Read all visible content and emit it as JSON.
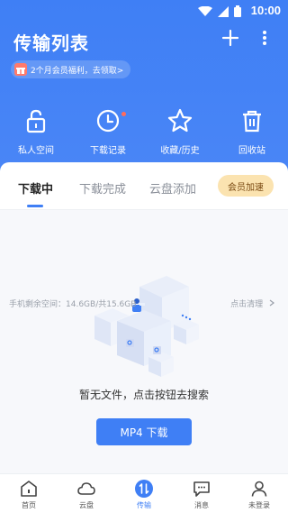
{
  "status_bar": {
    "time": "10:00"
  },
  "header": {
    "title": "传输列表",
    "promo_text": "2个月会员福利，去领取>",
    "plus_icon": "plus-icon",
    "more_icon": "more-vertical-icon"
  },
  "quick_actions": [
    {
      "label": "私人空间",
      "icon": "unlock-icon"
    },
    {
      "label": "下载记录",
      "icon": "clock-icon"
    },
    {
      "label": "收藏/历史",
      "icon": "star-icon"
    },
    {
      "label": "回收站",
      "icon": "trash-icon"
    }
  ],
  "tabs": [
    {
      "label": "下载中",
      "active": true
    },
    {
      "label": "下载完成",
      "active": false
    },
    {
      "label": "云盘添加",
      "active": false
    }
  ],
  "vip_button": "会员加速",
  "empty_state": {
    "message": "暂无文件，点击按钮去搜索",
    "button": "MP4 下载"
  },
  "footer": {
    "storage": "手机剩余空间：14.6GB/共15.6GB",
    "clean": "点击清理"
  },
  "bottom_nav": [
    {
      "label": "首页",
      "icon": "home-icon",
      "active": false
    },
    {
      "label": "云盘",
      "icon": "cloud-icon",
      "active": false
    },
    {
      "label": "传输",
      "icon": "transfer-icon",
      "active": true
    },
    {
      "label": "消息",
      "icon": "message-icon",
      "active": false
    },
    {
      "label": "未登录",
      "icon": "user-icon",
      "active": false
    }
  ],
  "colors": {
    "primary": "#3f7ff5",
    "vip_bg": "#fbe3b0",
    "vip_text": "#7a4a12",
    "badge_red": "#ff6b5b"
  }
}
